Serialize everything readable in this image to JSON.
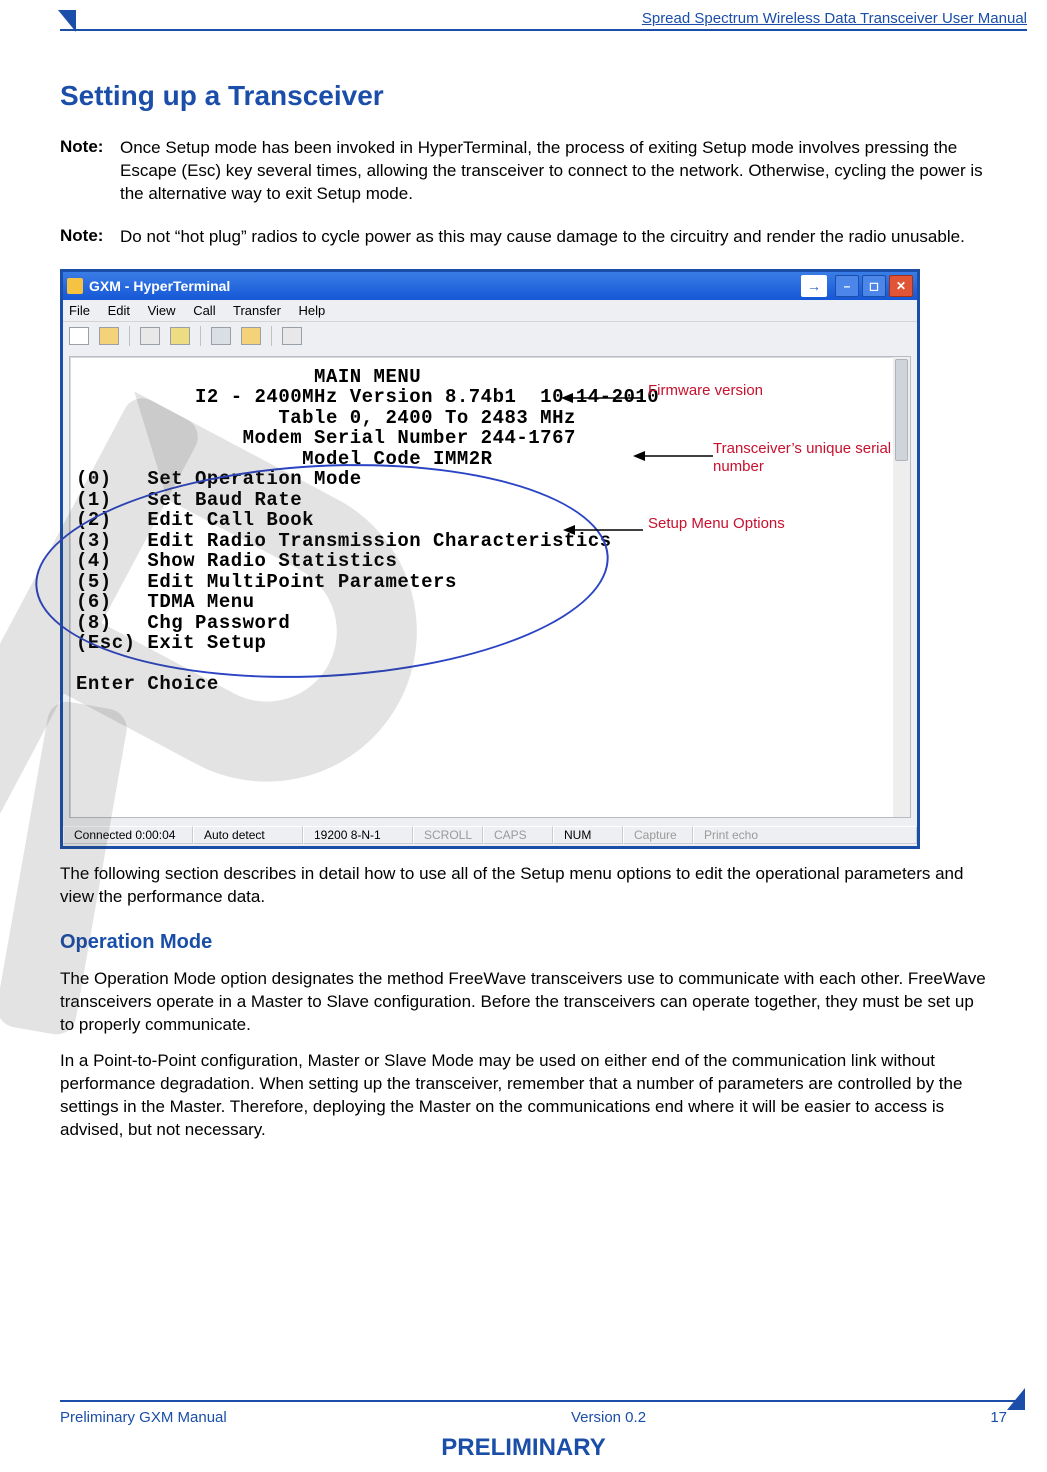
{
  "header_text": "Spread Spectrum Wireless Data Transceiver User Manual",
  "title": "Setting up a Transceiver",
  "notes": [
    {
      "label": "Note:",
      "text": "Once Setup mode has been invoked in HyperTerminal, the process of exiting Setup mode involves pressing the Escape (Esc) key several times, allowing the transceiver to connect to the network. Otherwise, cycling the power is the alternative way to exit Setup mode."
    },
    {
      "label": "Note:",
      "text": "Do not “hot plug” radios to cycle power as this may cause damage to the circuitry and render the radio unusable."
    }
  ],
  "hyperterminal": {
    "title": "GXM - HyperTerminal",
    "menus": [
      "File",
      "Edit",
      "View",
      "Call",
      "Transfer",
      "Help"
    ],
    "terminal": {
      "line_main_menu": "                    MAIN MENU",
      "line_version": "          I2 - 2400MHz Version 8.74b1  10-14-2010",
      "line_table": "                 Table 0, 2400 To 2483 MHz",
      "line_serial": "              Modem Serial Number 244-1767",
      "line_model": "                   Model Code IMM2R",
      "items": [
        "(0)   Set Operation Mode",
        "(1)   Set Baud Rate",
        "(2)   Edit Call Book",
        "(3)   Edit Radio Transmission Characteristics",
        "(4)   Show Radio Statistics",
        "(5)   Edit MultiPoint Parameters",
        "(6)   TDMA Menu",
        "(8)   Chg Password",
        "(Esc) Exit Setup"
      ],
      "prompt": "Enter Choice"
    },
    "status": {
      "connected": "Connected 0:00:04",
      "detect": "Auto detect",
      "port": "19200 8-N-1",
      "scroll": "SCROLL",
      "caps": "CAPS",
      "num": "NUM",
      "capture": "Capture",
      "echo": "Print echo"
    }
  },
  "annotations": {
    "firmware": "Firmware version",
    "serial": "Transceiver’s unique serial number",
    "setup": "Setup Menu Options"
  },
  "body_after_image": "The following section describes in detail how to use all of the Setup menu options to edit the operational parameters and view the performance data.",
  "section_heading": "Operation Mode",
  "op_p1": "The Operation Mode option designates the method FreeWave transceivers use to communicate with each other. FreeWave transceivers operate in a Master to Slave configuration. Before the transceivers can operate together, they must be set up to properly communicate.",
  "op_p2": "In a Point-to-Point configuration, Master or Slave Mode may be used on either end of the communication link without performance degradation. When setting up the transceiver, remember that a number of parameters are controlled by the settings in the Master. Therefore, deploying the Master on the communications end where it will be easier to access is advised, but not necessary.",
  "footer": {
    "left": "Preliminary GXM Manual",
    "center": "Version 0.2",
    "right": "17"
  },
  "preliminary": "PRELIMINARY"
}
